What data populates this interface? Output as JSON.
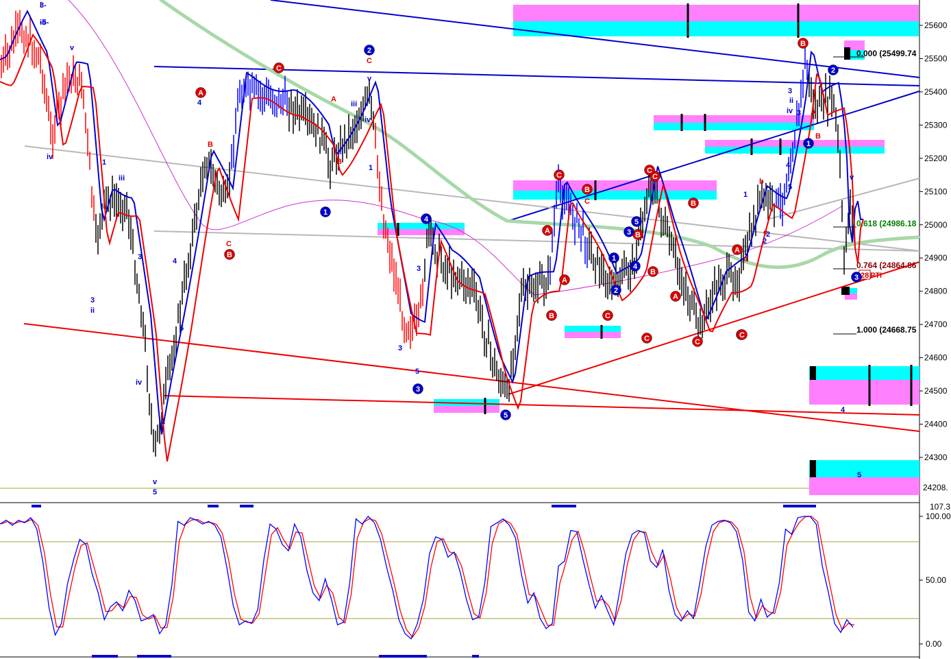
{
  "chart_data": [
    {
      "type": "candlestick",
      "panel": "price",
      "y_axis_ticks": [
        25600,
        25500,
        25400,
        25300,
        25200,
        25100,
        25000,
        24900,
        24800,
        24700,
        24600,
        24500,
        24400,
        24300
      ],
      "ylim": [
        24200,
        25690
      ],
      "last_price_label": "24208.",
      "fib_levels": [
        {
          "label": "0.000 (25499.74",
          "value": 25499.74,
          "color": "#000000"
        },
        {
          "label": "0.618 (24986.18",
          "value": 24986.18,
          "color": "#008000"
        },
        {
          "label": "0.764 (24864.86",
          "value": 24864.86,
          "color": "#8b0000"
        },
        {
          "label": "1.000 (24668.75",
          "value": 24668.75,
          "color": "#000000"
        }
      ],
      "pti_label": "28",
      "pti_text": "PTI",
      "wave_labels_blue": [
        "i",
        "iii",
        "iv",
        "v",
        "3",
        "ii",
        "iii",
        "iv",
        "3",
        "4",
        "v",
        "5",
        "2",
        "5",
        "4",
        "3",
        "5",
        "3",
        "1",
        "ii",
        "iii",
        "iv",
        "v",
        "1",
        "2",
        "3",
        "4",
        "5",
        "ii",
        "iv",
        "3",
        "v",
        "4",
        "5",
        "1",
        "2",
        "3-",
        "-5-"
      ],
      "wave_labels_red": [
        "B",
        "C",
        "A",
        "B",
        "C",
        "a",
        "b",
        "c",
        "C",
        "A",
        "B"
      ],
      "circle_labels_red": [
        "A",
        "C",
        "B",
        "C",
        "A",
        "B",
        "C",
        "B",
        "A",
        "C",
        "C",
        "B",
        "A",
        "B",
        "A",
        "C",
        "B",
        "A",
        "B",
        "C",
        "C"
      ],
      "circle_labels_blue": [
        "2",
        "1",
        "4",
        "3",
        "5",
        "1",
        "5",
        "3",
        "4",
        "2",
        "1",
        "2",
        "3"
      ]
    },
    {
      "type": "line",
      "panel": "oscillator",
      "y_axis_ticks": [
        100.0,
        50.0,
        0.0
      ],
      "ylim": [
        0,
        107.3
      ],
      "top_value_label": "107.3",
      "series": [
        {
          "color": "#0000ff"
        },
        {
          "color": "#ff0000"
        }
      ],
      "osc_points": [
        94,
        97,
        93,
        97,
        95,
        99,
        90,
        64,
        28,
        7,
        16,
        47,
        66,
        82,
        78,
        55,
        40,
        19,
        29,
        33,
        26,
        42,
        34,
        18,
        20,
        23,
        8,
        15,
        46,
        96,
        93,
        99,
        97,
        94,
        96,
        93,
        84,
        59,
        30,
        15,
        18,
        16,
        27,
        66,
        94,
        90,
        78,
        73,
        94,
        84,
        58,
        40,
        34,
        51,
        35,
        15,
        17,
        48,
        98,
        94,
        100,
        95,
        82,
        60,
        42,
        19,
        8,
        4,
        16,
        35,
        71,
        84,
        82,
        68,
        72,
        56,
        35,
        19,
        21,
        48,
        92,
        95,
        98,
        93,
        83,
        54,
        32,
        40,
        20,
        12,
        16,
        61,
        65,
        89,
        88,
        66,
        46,
        28,
        38,
        26,
        15,
        42,
        71,
        86,
        89,
        87,
        65,
        60,
        74,
        42,
        23,
        18,
        26,
        20,
        47,
        76,
        93,
        96,
        97,
        95,
        88,
        66,
        25,
        18,
        35,
        21,
        25,
        48,
        90,
        86,
        99,
        100,
        100,
        94,
        61,
        40,
        16,
        9,
        19,
        13
      ]
    }
  ],
  "colors": {
    "cyan": "#00ffff",
    "magenta": "#ff80ff",
    "blue_band": "#0000d0",
    "red_band": "#ee0000",
    "green_ma": "#a8d8a8",
    "gray_line": "#b8b8b8",
    "purple_line": "#cc33cc",
    "olive_grid": "#a0a040"
  }
}
